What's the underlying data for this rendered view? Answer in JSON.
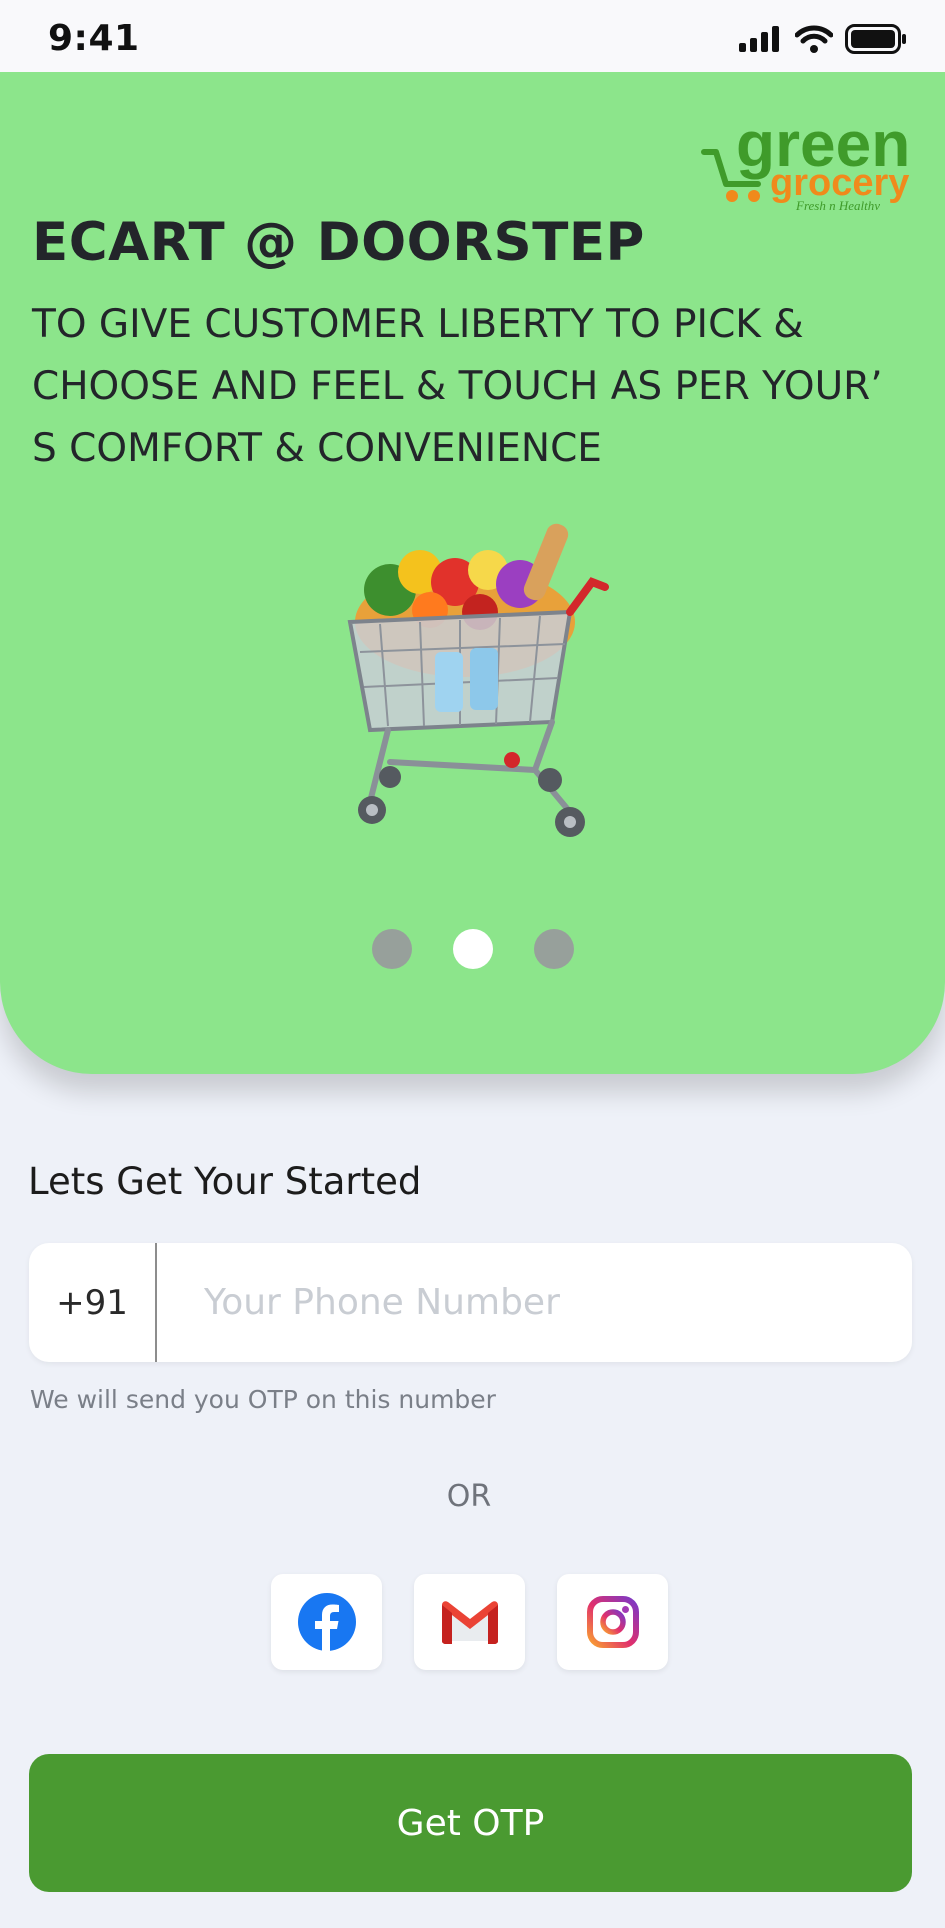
{
  "status_bar": {
    "time": "9:41"
  },
  "brand": {
    "line1": "green",
    "line2": "grocery",
    "tagline": "Fresh n Healthy"
  },
  "hero": {
    "title": "ECART @ DOORSTEP",
    "subtitle": "TO GIVE CUSTOMER LIBERTY TO PICK & CHOOSE AND FEEL & TOUCH AS PER YOUR’ S COMFORT & CONVENIENCE",
    "image": "shopping-cart-with-groceries",
    "carousel": {
      "total": 3,
      "active_index": 1
    }
  },
  "login": {
    "heading": "Lets Get Your Started",
    "country_code": "+91",
    "phone_placeholder": "Your Phone Number",
    "phone_value": "",
    "hint": "We will send you OTP on this number",
    "or_label": "OR",
    "socials": [
      {
        "name": "facebook",
        "icon": "facebook-icon"
      },
      {
        "name": "gmail",
        "icon": "gmail-icon"
      },
      {
        "name": "instagram",
        "icon": "instagram-icon"
      }
    ],
    "cta_label": "Get OTP"
  },
  "colors": {
    "hero_bg": "#8ce58b",
    "cta_bg": "#4a9a31",
    "page_bg": "#eef1f8"
  }
}
